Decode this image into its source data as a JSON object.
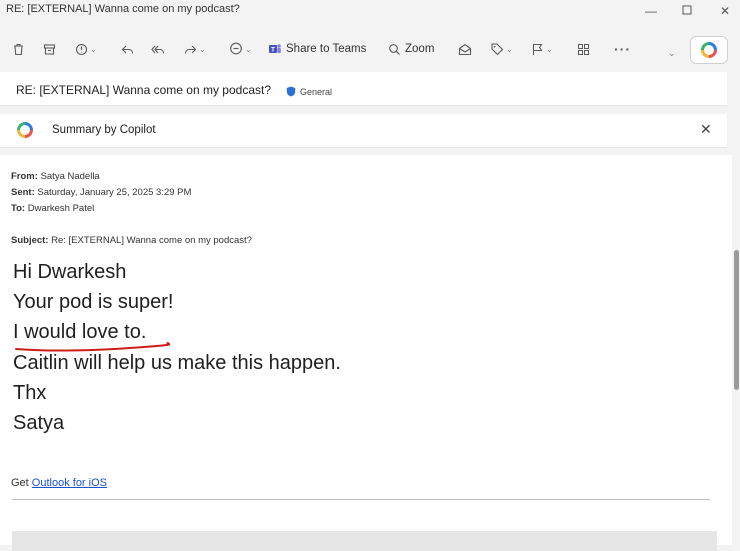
{
  "window": {
    "title": "RE: [EXTERNAL] Wanna come on my podcast?",
    "controls": [
      "minimize",
      "maximize",
      "close"
    ]
  },
  "toolbar": {
    "items": [
      "delete",
      "archive",
      "report",
      "reply",
      "reply-all",
      "forward",
      "teams-chat",
      "share-to-teams",
      "zoom",
      "mark-read",
      "tag",
      "flag",
      "apps",
      "more"
    ],
    "share_to_teams_label": "Share to Teams",
    "zoom_label": "Zoom",
    "more_label": "···",
    "copilot_button": "copilot-icon"
  },
  "subject_bar": {
    "subject": "RE: [EXTERNAL] Wanna come on my podcast?",
    "sensitivity_label": "General",
    "label_color": "#2f6fd1"
  },
  "copilot_summary": {
    "label": "Summary by Copilot",
    "close_icon": "close-icon"
  },
  "message": {
    "from_label": "From:",
    "from": "Satya Nadella",
    "sent_label": "Sent:",
    "sent": "Saturday, January 25, 2025 3:29 PM",
    "to_label": "To:",
    "to": "Dwarkesh Patel",
    "subject_label": "Subject:",
    "subject": "Re: [EXTERNAL] Wanna come on my podcast?",
    "body": [
      "Hi Dwarkesh",
      "Your pod is super!",
      "I would love to.",
      "Caitlin will help us make this happen.",
      "Thx",
      "Satya"
    ],
    "footer_prefix": "Get ",
    "footer_link": "Outlook for iOS",
    "underline_color": "#d01b1b"
  }
}
